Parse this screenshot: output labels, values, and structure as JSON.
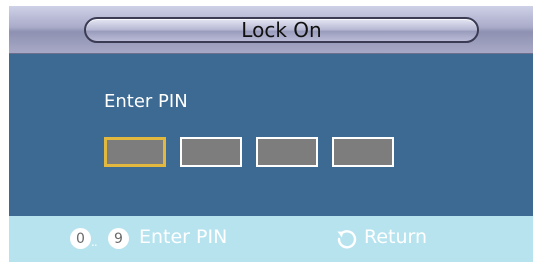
{
  "title": "Lock On",
  "prompt": "Enter PIN",
  "pin_slots": 4,
  "active_slot": 1,
  "footer": {
    "range_start": "0",
    "range_separator": "..",
    "range_end": "9",
    "enter_label": "Enter PIN",
    "return_label": "Return",
    "return_icon": "return-arrow-icon"
  },
  "colors": {
    "panel": "#3c6a93",
    "footer": "#b7e3ef",
    "active_border": "#e2b93e",
    "slot_fill": "#7d7d7d"
  }
}
